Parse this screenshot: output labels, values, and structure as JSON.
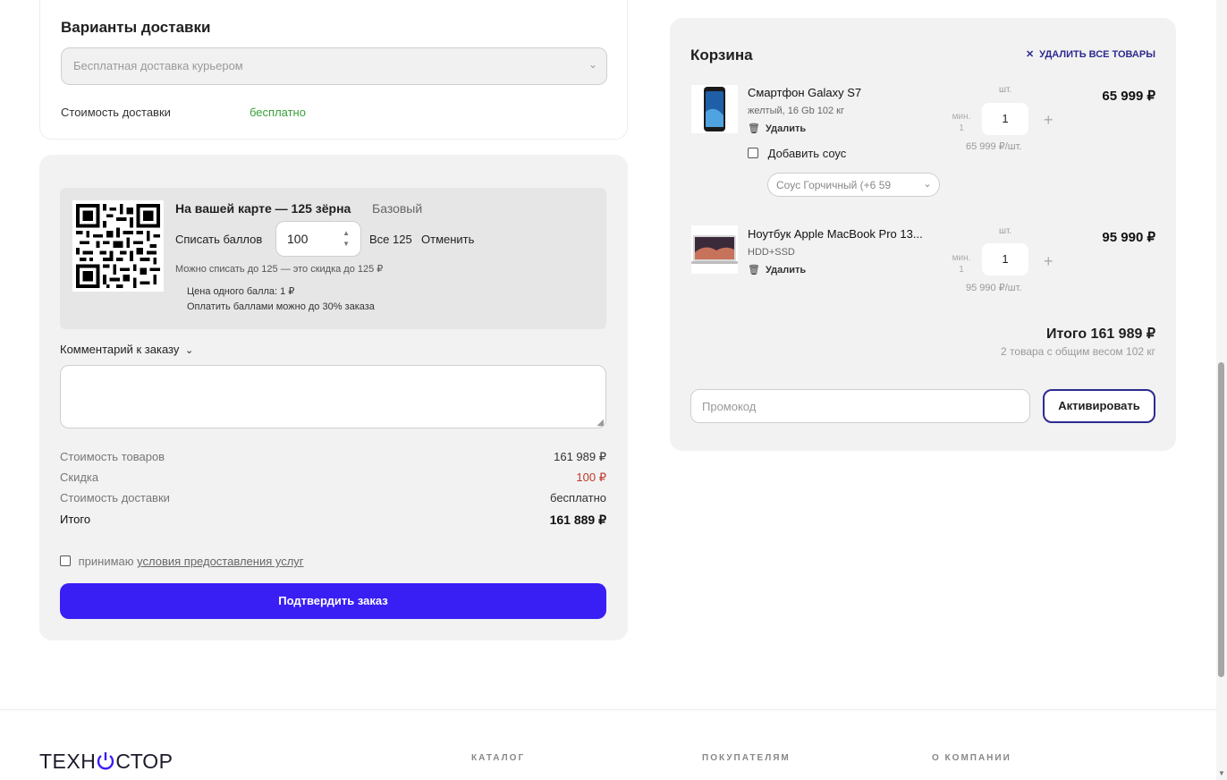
{
  "delivery": {
    "title": "Варианты доставки",
    "selected": "Бесплатная доставка курьером",
    "cost_label": "Стоимость доставки",
    "cost_value": "бесплатно"
  },
  "loyalty": {
    "title": "На вашей карте — 125 зёрна",
    "level": "Базовый",
    "writeoff_label": "Списать баллов",
    "points_value": "100",
    "all_label": "Все 125",
    "cancel_label": "Отменить",
    "note": "Можно списать до 125 — это скидка до 125 ₽",
    "point_price": "Цена одного балла: 1 ₽",
    "limit": "Оплатить баллами можно до 30% заказа"
  },
  "comment": {
    "toggle": "Комментарий к заказу"
  },
  "summary": {
    "goods_label": "Стоимость товаров",
    "goods_value": "161 989 ₽",
    "discount_label": "Скидка",
    "discount_value": "100 ₽",
    "delivery_label": "Стоимость доставки",
    "delivery_value": "бесплатно",
    "total_label": "Итого",
    "total_value": "161 889 ₽"
  },
  "terms": {
    "prefix": "принимаю",
    "link": "условия предоставления услуг"
  },
  "confirm_label": "Подтвердить заказ",
  "cart": {
    "title": "Корзина",
    "clear_label": "УДАЛИТЬ ВСЕ ТОВАРЫ",
    "items": [
      {
        "name": "Смартфон Galaxy S7",
        "sub": "желтый, 16 Gb 102 кг",
        "delete": "Удалить",
        "unit": "шт.",
        "min_label": "мин.",
        "min_value": "1",
        "qty": "1",
        "unit_price": "65 999 ₽/шт.",
        "price": "65 999 ₽",
        "sauce_label": "Добавить соус",
        "sauce_value": "Соус Горчичный (+6 59"
      },
      {
        "name": "Ноутбук Apple MacBook Pro 13...",
        "sub": "HDD+SSD",
        "delete": "Удалить",
        "unit": "шт.",
        "min_label": "мин.",
        "min_value": "1",
        "qty": "1",
        "unit_price": "95 990 ₽/шт.",
        "price": "95 990 ₽"
      }
    ],
    "total": "Итого 161 989 ₽",
    "weight": "2 товара с общим весом 102 кг",
    "promo_placeholder": "Промокод",
    "promo_button": "Активировать"
  },
  "footer": {
    "logo_left": "ТЕХН",
    "logo_right": "СТОР",
    "nav": [
      "КАТАЛОГ",
      "ПОКУПАТЕЛЯМ",
      "О КОМПАНИИ"
    ]
  },
  "colors": {
    "accent": "#3a1ff5",
    "cart_accent": "#2d2a8f",
    "success": "#3aa03a",
    "discount": "#c0392b"
  }
}
